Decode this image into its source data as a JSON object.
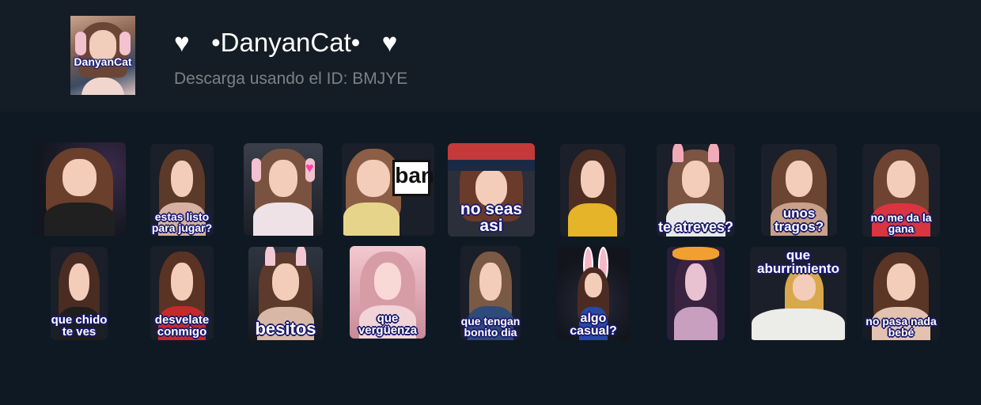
{
  "header": {
    "title": "♥   •DanyanCat•   ♥",
    "subtitle": "Descarga usando el ID: BMJYE",
    "thumbnail_logo_text": "DanyanCat"
  },
  "colors": {
    "background": "#0f1923",
    "header_background": "#141d25",
    "subtitle": "#7c8187",
    "caption_outline": "#1b1a6e"
  },
  "stickers_row1": [
    {
      "caption": ""
    },
    {
      "caption": "estas listo\npara jugar?"
    },
    {
      "caption": ""
    },
    {
      "caption": "ban"
    },
    {
      "caption": "no seas asi"
    },
    {
      "caption": ""
    },
    {
      "caption": "te atreves?"
    },
    {
      "caption": "unos tragos?"
    },
    {
      "caption": "no me da la\ngana"
    }
  ],
  "stickers_row2": [
    {
      "caption": "que chido\nte ves"
    },
    {
      "caption": "desvelate\nconmigo"
    },
    {
      "caption": "besitos"
    },
    {
      "caption": "que vergüenza"
    },
    {
      "caption": "que tengan\nbonito dia"
    },
    {
      "caption": "algo casual?"
    },
    {
      "caption": ""
    },
    {
      "caption": "que aburrimiento"
    },
    {
      "caption": "no pasa nada\nbebé"
    }
  ]
}
